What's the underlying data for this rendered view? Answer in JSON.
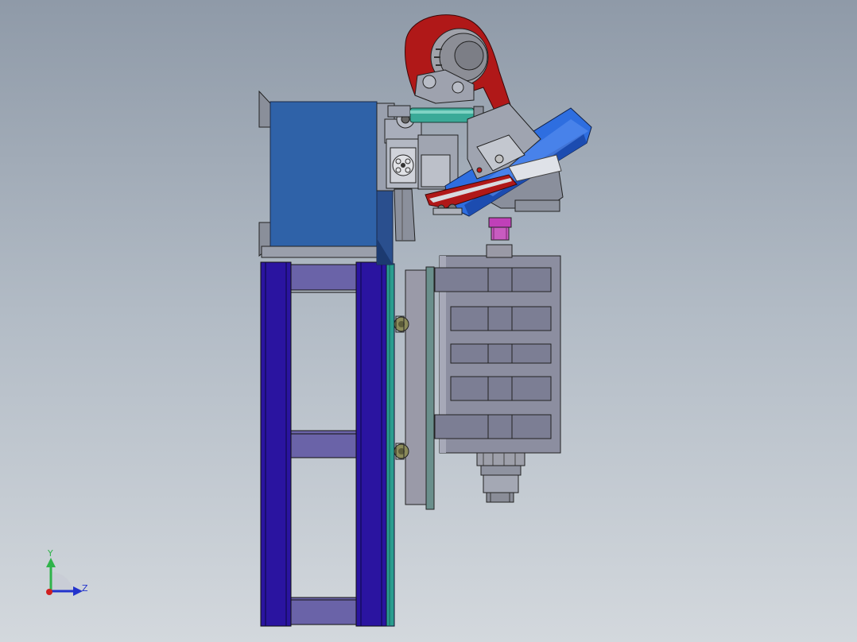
{
  "triad": {
    "y_label": "Y",
    "z_label": "Z",
    "y_color": "#2fb34a",
    "z_color": "#2233cc",
    "x_color": "#d02020"
  },
  "palette": {
    "frame_blue": "#2a14a0",
    "crossbar_purple": "#6a63a8",
    "motor_blue": "#2f62a8",
    "belt_red": "#b01818",
    "cylinder_teal": "#3aaa98",
    "table_blue": "#2e6ee0",
    "coupling_magenta": "#c040b8",
    "housing_gray": "#8c8ea0",
    "rail_teal": "#2a9d8f"
  }
}
